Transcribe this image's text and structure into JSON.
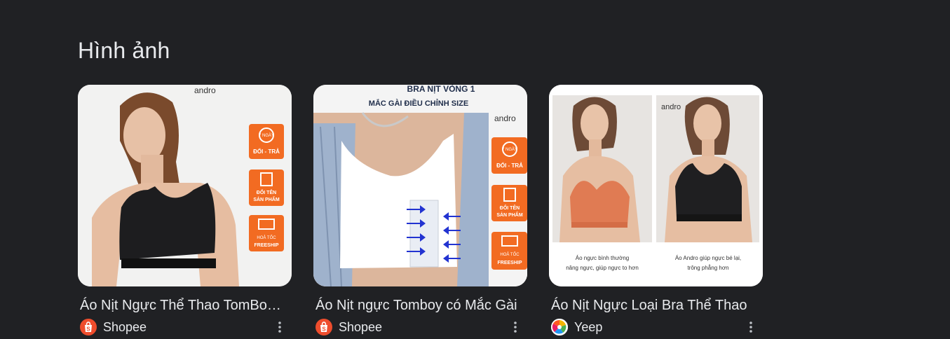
{
  "section": {
    "title": "Hình ảnh"
  },
  "results": [
    {
      "caption": "Áo Nịt Ngực Thể Thao TomBoy Andro",
      "source": "Shopee",
      "favicon": "shopee-icon",
      "image_text": {
        "brand": "andro",
        "badge1": [
          "7 NGÀY",
          "ĐỔI - TRẢ"
        ],
        "badge2": [
          "ĐỔI TÊN",
          "SẢN PHẨM"
        ],
        "badge3": [
          "HOẢ TỐC",
          "FREESHIP"
        ]
      }
    },
    {
      "caption": "Áo Nịt ngực Tomboy có Mắc Gài",
      "source": "Shopee",
      "favicon": "shopee-icon",
      "image_text": {
        "headline1": "BRA NỊT VÒNG 1",
        "headline2": "MẮC GÀI ĐIỀU CHỈNH SIZE",
        "brand": "andro",
        "badge1": [
          "7 NGÀY",
          "ĐỔI - TRẢ"
        ],
        "badge2": [
          "ĐỔI TÊN",
          "SẢN PHẨM"
        ],
        "badge3": [
          "HOẢ TỐC",
          "FREESHIP"
        ]
      }
    },
    {
      "caption": "Áo Nịt Ngực Loại Bra Thể Thao",
      "source": "Yeep",
      "favicon": "yeep-icon",
      "image_text": {
        "brand": "andro",
        "left_caption1": "Áo ngực bình thường",
        "left_caption2": "nâng ngực, giúp ngực to hơn",
        "right_caption1": "Áo Andro giúp ngực bé lại,",
        "right_caption2": "trông phẳng hơn"
      }
    }
  ],
  "colors": {
    "background": "#202124",
    "text": "#e8eaed",
    "badge": "#f26b22",
    "shopee": "#ee4d2d"
  }
}
